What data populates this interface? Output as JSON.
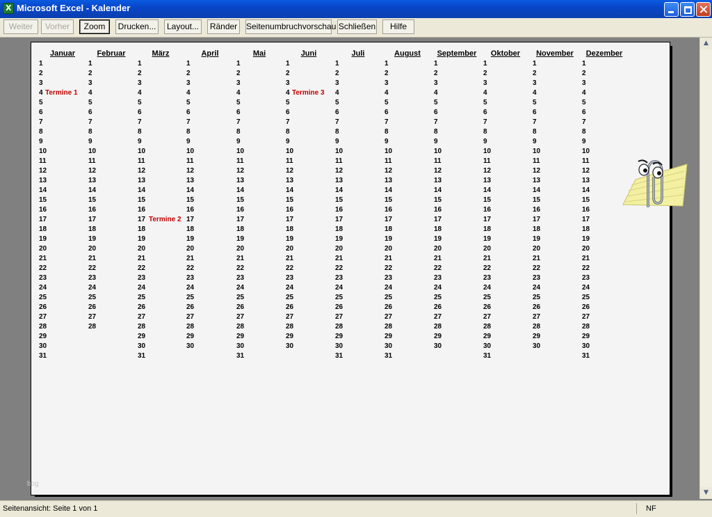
{
  "window": {
    "title": "Microsoft Excel - Kalender"
  },
  "toolbar": {
    "buttons": [
      {
        "label": "Weiter",
        "state": "disabled"
      },
      {
        "label": "Vorher",
        "state": "disabled"
      },
      {
        "label": "Zoom",
        "state": "active"
      },
      {
        "label": "Drucken...",
        "state": "normal"
      },
      {
        "label": "Layout...",
        "state": "normal"
      },
      {
        "label": "Ränder",
        "state": "normal"
      },
      {
        "label": "Seitenumbruchvorschau",
        "state": "normal"
      },
      {
        "label": "Schließen",
        "state": "normal"
      },
      {
        "label": "Hilfe",
        "state": "normal"
      }
    ]
  },
  "calendar": {
    "months": [
      {
        "name": "Januar",
        "days": 31
      },
      {
        "name": "Februar",
        "days": 28
      },
      {
        "name": "März",
        "days": 31
      },
      {
        "name": "April",
        "days": 30
      },
      {
        "name": "Mai",
        "days": 31
      },
      {
        "name": "Juni",
        "days": 30
      },
      {
        "name": "Juli",
        "days": 31
      },
      {
        "name": "August",
        "days": 31
      },
      {
        "name": "September",
        "days": 30
      },
      {
        "name": "Oktober",
        "days": 31
      },
      {
        "name": "November",
        "days": 30
      },
      {
        "name": "Dezember",
        "days": 31
      }
    ],
    "appointments": [
      {
        "month_index": 0,
        "day": 4,
        "label": "Termine 1"
      },
      {
        "month_index": 2,
        "day": 17,
        "label": "Termine 2"
      },
      {
        "month_index": 5,
        "day": 4,
        "label": "Termine 3"
      }
    ]
  },
  "watermark": "bog",
  "statusbar": {
    "left": "Seitenansicht: Seite 1 von 1",
    "right": "NF"
  },
  "colors": {
    "titlebar": "#0846c8",
    "appointment": "#c00000",
    "background": "#808080"
  },
  "icons": [
    "excel-app-icon",
    "minimize-icon",
    "restore-icon",
    "close-icon",
    "scroll-up-icon",
    "scroll-down-icon",
    "office-assistant-clippy"
  ]
}
